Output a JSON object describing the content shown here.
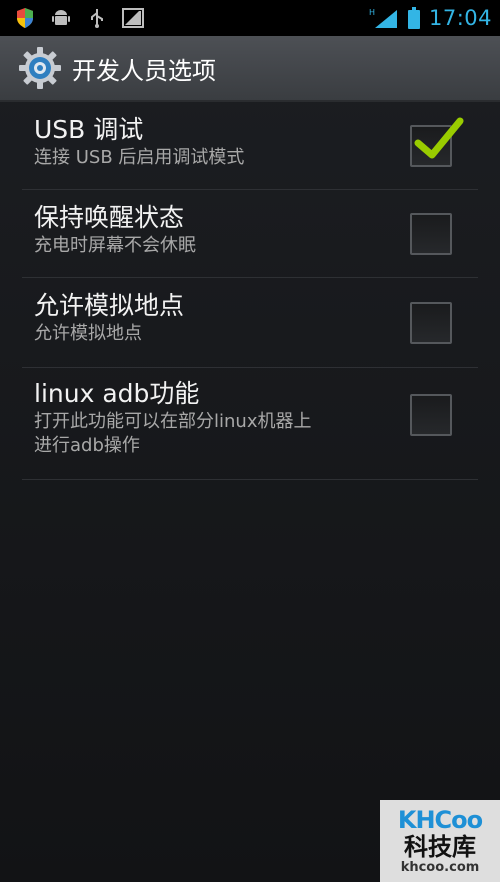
{
  "status_bar": {
    "icons": [
      "shield-icon",
      "android-icon",
      "usb-icon",
      "image-icon"
    ],
    "right_icons": [
      "signal-icon",
      "battery-icon"
    ],
    "network_label": "H",
    "time": "17:04"
  },
  "action_bar": {
    "icon": "settings-gear-icon",
    "title": "开发人员选项"
  },
  "items": [
    {
      "title": "USB 调试",
      "subtitle": "连接 USB 后启用调试模式",
      "checked": true
    },
    {
      "title": "保持唤醒状态",
      "subtitle": "充电时屏幕不会休眠",
      "checked": false
    },
    {
      "title": "允许模拟地点",
      "subtitle": "允许模拟地点",
      "checked": false
    },
    {
      "title": "linux adb功能",
      "subtitle_line1": "打开此功能可以在部分linux机器上",
      "subtitle_line2": "进行adb操作",
      "checked": false
    }
  ],
  "watermark": {
    "logo": "KHCoo",
    "name": "科技库",
    "url": "khcoo.com"
  },
  "colors": {
    "accent": "#33b5e5",
    "check": "#99cc00"
  }
}
